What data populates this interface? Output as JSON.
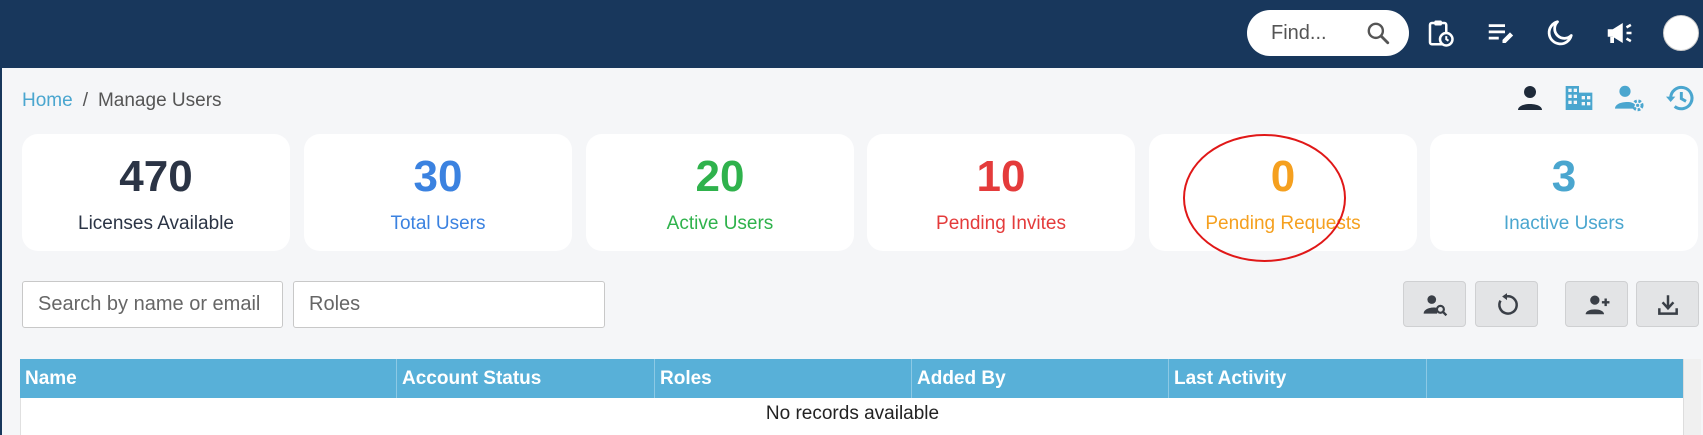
{
  "topbar": {
    "search_placeholder": "Find...",
    "icons": [
      "search-icon",
      "clipboard-clock-icon",
      "edit-list-icon",
      "moon-icon",
      "megaphone-icon",
      "avatar"
    ]
  },
  "breadcrumb": {
    "home": "Home",
    "separator": "/",
    "current": "Manage Users"
  },
  "header_icons": [
    "user-icon",
    "building-icon",
    "user-settings-icon",
    "history-icon"
  ],
  "stats": [
    {
      "value": "470",
      "label": "Licenses Available",
      "color": "#2b3445"
    },
    {
      "value": "30",
      "label": "Total Users",
      "color": "#3b82e0"
    },
    {
      "value": "20",
      "label": "Active Users",
      "color": "#2fb24c"
    },
    {
      "value": "10",
      "label": "Pending Invites",
      "color": "#e43b3b"
    },
    {
      "value": "0",
      "label": "Pending Requests",
      "color": "#f5a01f"
    },
    {
      "value": "3",
      "label": "Inactive Users",
      "color": "#4aa6cf"
    }
  ],
  "filters": {
    "search_placeholder": "Search by name or email",
    "roles_placeholder": "Roles"
  },
  "actions": [
    "user-search-icon",
    "refresh-icon",
    "add-user-icon",
    "download-icon"
  ],
  "table": {
    "columns": [
      "Name",
      "Account Status",
      "Roles",
      "Added By",
      "Last Activity",
      ""
    ],
    "empty_message": "No records available"
  },
  "colors": {
    "topbar": "#18375c",
    "accent": "#4aa6cf",
    "table_header": "#58b0d8",
    "highlight_circle": "#e01818"
  }
}
